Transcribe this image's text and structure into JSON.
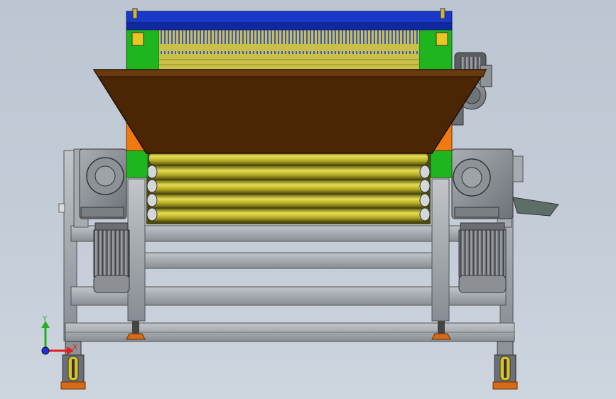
{
  "viewport": {
    "background_top": "#bcc6d2",
    "background_bottom": "#cdd5df"
  },
  "model": {
    "colors": {
      "top_cover": "#1a39c8",
      "side_plate": "#1fb51f",
      "hopper": "#4a2605",
      "hopper_side": "#f07a10",
      "rollers": "#c8bd2a",
      "frame": "#9aa0a6",
      "motor": "#7d8185",
      "foot": "#d56a18"
    },
    "parts": [
      "top-cover",
      "brush-bar",
      "hopper",
      "roller-bank",
      "gear-motor-left",
      "gear-motor-right",
      "electric-motor-left",
      "electric-motor-right",
      "upper-drive-motor",
      "base-frame",
      "caster-left",
      "caster-right",
      "discharge-chute"
    ]
  },
  "triad": {
    "x_label": "X",
    "y_label": "Y",
    "x_color": "#e02020",
    "y_color": "#20b020",
    "z_color": "#2030e0"
  }
}
